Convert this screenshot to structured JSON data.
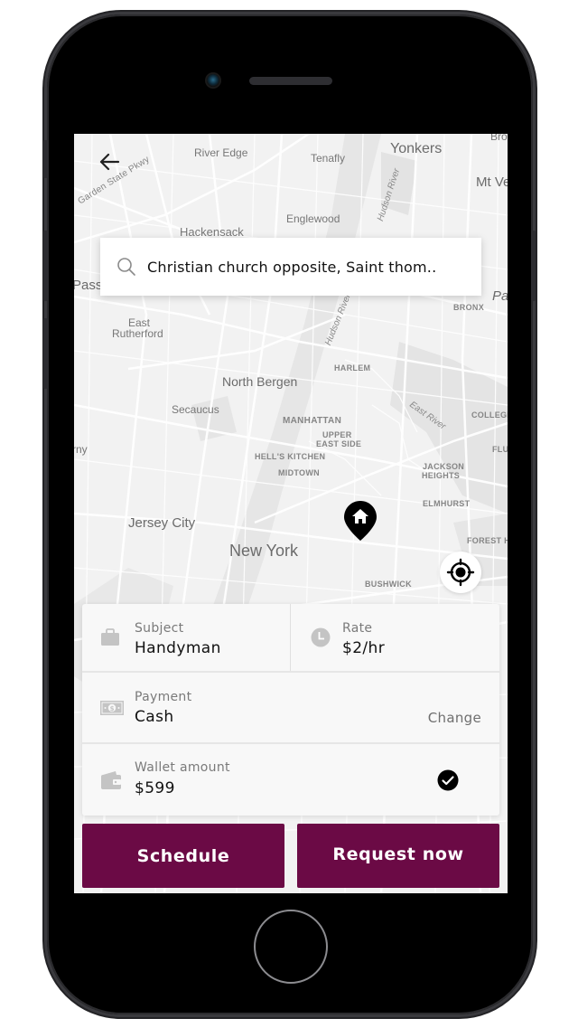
{
  "device": {
    "type": "phone-mockup"
  },
  "map": {
    "labels": [
      {
        "text": "River Edge",
        "size": "m"
      },
      {
        "text": "Tenafly",
        "size": "m"
      },
      {
        "text": "Yonkers",
        "size": "l"
      },
      {
        "text": "Mt Ve",
        "size": "l"
      },
      {
        "text": "Bro",
        "size": "m"
      },
      {
        "text": "Garden State Pkwy",
        "size": "s"
      },
      {
        "text": "Englewood",
        "size": "m"
      },
      {
        "text": "Hudson River",
        "size": "i"
      },
      {
        "text": "Hackensack",
        "size": "m"
      },
      {
        "text": "Pass",
        "size": "l"
      },
      {
        "text": "Pa",
        "size": "l"
      },
      {
        "text": "BRONX",
        "size": "s"
      },
      {
        "text": "East",
        "size": "m"
      },
      {
        "text": "Rutherford",
        "size": "m"
      },
      {
        "text": "Hudson River",
        "size": "i"
      },
      {
        "text": "HARLEM",
        "size": "s"
      },
      {
        "text": "North Bergen",
        "size": "l"
      },
      {
        "text": "Secaucus",
        "size": "m"
      },
      {
        "text": "East River",
        "size": "i"
      },
      {
        "text": "COLLEGE",
        "size": "s"
      },
      {
        "text": "MANHATTAN",
        "size": "s"
      },
      {
        "text": "UPPER",
        "size": "s"
      },
      {
        "text": "EAST SIDE",
        "size": "s"
      },
      {
        "text": "rny",
        "size": "m"
      },
      {
        "text": "FLU",
        "size": "s"
      },
      {
        "text": "HELL'S KITCHEN",
        "size": "s"
      },
      {
        "text": "MIDTOWN",
        "size": "s"
      },
      {
        "text": "JACKSON",
        "size": "s"
      },
      {
        "text": "HEIGHTS",
        "size": "s"
      },
      {
        "text": "ELMHURST",
        "size": "s"
      },
      {
        "text": "Jersey City",
        "size": "l"
      },
      {
        "text": "New York",
        "size": "xl"
      },
      {
        "text": "FOREST H",
        "size": "s"
      },
      {
        "text": "BUSHWICK",
        "size": "s"
      }
    ]
  },
  "header": {
    "back_icon": "arrow-left-icon"
  },
  "search": {
    "icon": "search-icon",
    "value": "Christian church opposite, Saint thom.."
  },
  "markers": {
    "home": "home-pin-icon",
    "locate": "crosshair-icon"
  },
  "details": {
    "subject": {
      "label": "Subject",
      "value": "Handyman",
      "icon": "briefcase-icon"
    },
    "rate": {
      "label": "Rate",
      "value": "$2/hr",
      "icon": "clock-icon"
    },
    "payment": {
      "label": "Payment",
      "value": "Cash",
      "icon": "cash-icon",
      "action": "Change"
    },
    "wallet": {
      "label": "Wallet amount",
      "value": "$599",
      "icon": "wallet-icon",
      "checked": true
    }
  },
  "actions": {
    "schedule": "Schedule",
    "request": "Request now"
  },
  "colors": {
    "primary": "#6b0a45",
    "map_bg": "#f3f3f3",
    "card_bg": "#f8f8f8"
  }
}
